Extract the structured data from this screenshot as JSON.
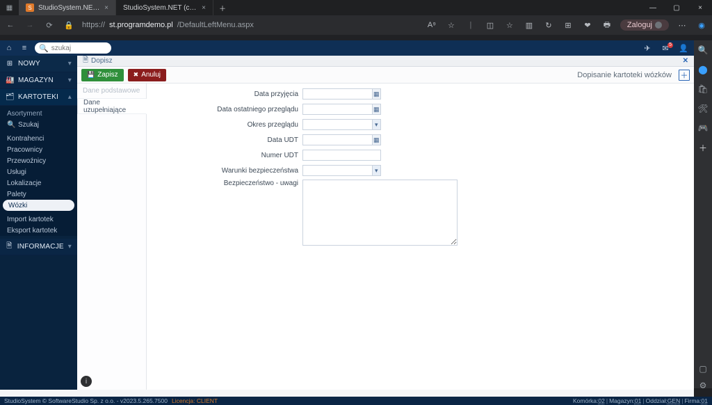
{
  "browser": {
    "tabs": [
      {
        "favicon": "S",
        "label": "StudioSystem.NET (c) SoftwareS",
        "active": true
      },
      {
        "favicon": "",
        "label": "StudioSystem.NET (c) SoftwareS",
        "active": false
      }
    ],
    "url_proto": "https://",
    "url_host": "st.programdemo.pl",
    "url_path": "/DefaultLeftMenu.aspx",
    "login_label": "Zaloguj"
  },
  "app_topbar": {
    "search_placeholder": "szukaj",
    "mail_badge": "5"
  },
  "leftnav": {
    "sections": {
      "nowy": "NOWY",
      "magazyn": "MAGAZYN",
      "kartoteki": "KARTOTEKI",
      "informacje": "INFORMACJE"
    },
    "kartoteki_items": {
      "asortyment": "Asortyment",
      "szukaj": "Szukaj",
      "kontrahenci": "Kontrahenci",
      "pracownicy": "Pracownicy",
      "przewoznicy": "Przewoźnicy",
      "uslugi": "Usługi",
      "lokalizacje": "Lokalizacje",
      "palety": "Palety",
      "wozki": "Wózki",
      "import": "Import kartotek",
      "eksport": "Eksport kartotek"
    }
  },
  "content": {
    "crumb": "Dopisz",
    "save": "Zapisz",
    "cancel": "Anuluj",
    "panel_title": "Dopisanie kartoteki wózków",
    "tabs": {
      "basic": "Dane podstawowe",
      "extra": "Dane uzupełniające"
    },
    "fields": {
      "data_przyjecia": "Data przyjęcia",
      "data_ost_przegladu": "Data ostatniego przeglądu",
      "okres_przegladu": "Okres przeglądu",
      "data_udt": "Data UDT",
      "numer_udt": "Numer UDT",
      "warunki": "Warunki bezpieczeństwa",
      "bezp_uwagi": "Bezpieczeństwo - uwagi"
    }
  },
  "statusbar": {
    "left": "StudioSystem © SoftwareStudio Sp. z o.o. - v2023.5.265.7500",
    "licence": "Licencja: CLIENT",
    "right_parts": {
      "komorka_lbl": "Komórka:",
      "komorka_val": "02",
      "magazyn_lbl": "Magazyn:",
      "magazyn_val": "01",
      "oddzial_lbl": "Oddział:",
      "oddzial_val": "GEN",
      "firma_lbl": "Firma:",
      "firma_val": "01"
    }
  }
}
